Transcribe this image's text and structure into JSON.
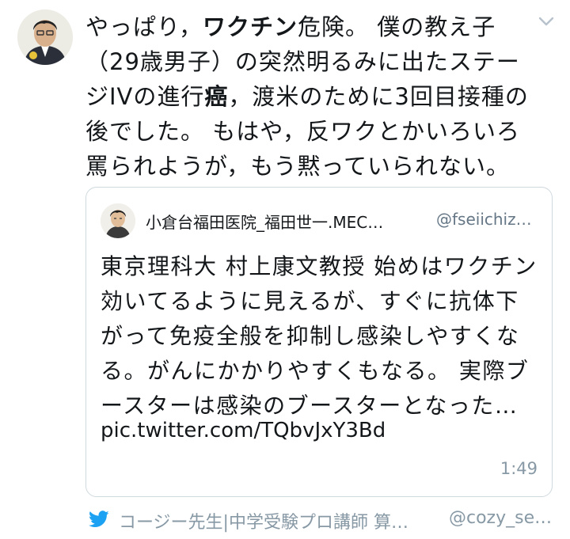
{
  "tweet": {
    "lines": [
      [
        "やっぱり，",
        "ワクチン",
        "危険。 僕の教え子"
      ],
      "（29歳男子）の突然明るみに出たステー",
      [
        "ジIVの進行",
        "癌",
        "，渡米のために3回目接種の"
      ],
      "後でした。 もはや，反ワクとかいろいろ",
      "罵られようが，もう黙っていられない。"
    ]
  },
  "quote": {
    "author_name": "小倉台福田医院_福田世一.MEC…",
    "author_handle": "@fseiichiz…",
    "lines": [
      "東京理科大 村上康文教授 始めはワクチン",
      "効いてるように見えるが、すぐに抗体下",
      "がって免疫全般を抑制し感染しやすくな",
      "る。がんにかかりやすくもなる。 実際ブ",
      "ースターは感染のブースターとなった…"
    ],
    "link": "pic.twitter.com/TQbvJxY3Bd",
    "time": "1:49"
  },
  "footer": {
    "author_name": "コージー先生|中学受験プロ講師 算…",
    "author_handle": "@cozy_se…"
  },
  "colors": {
    "text": "#14171a",
    "muted": "#8899a6",
    "border": "#cfd9de",
    "twitter_blue": "#1da1f2"
  },
  "icons": {
    "menu": "chevron-down-icon",
    "source": "twitter-bird-icon"
  }
}
